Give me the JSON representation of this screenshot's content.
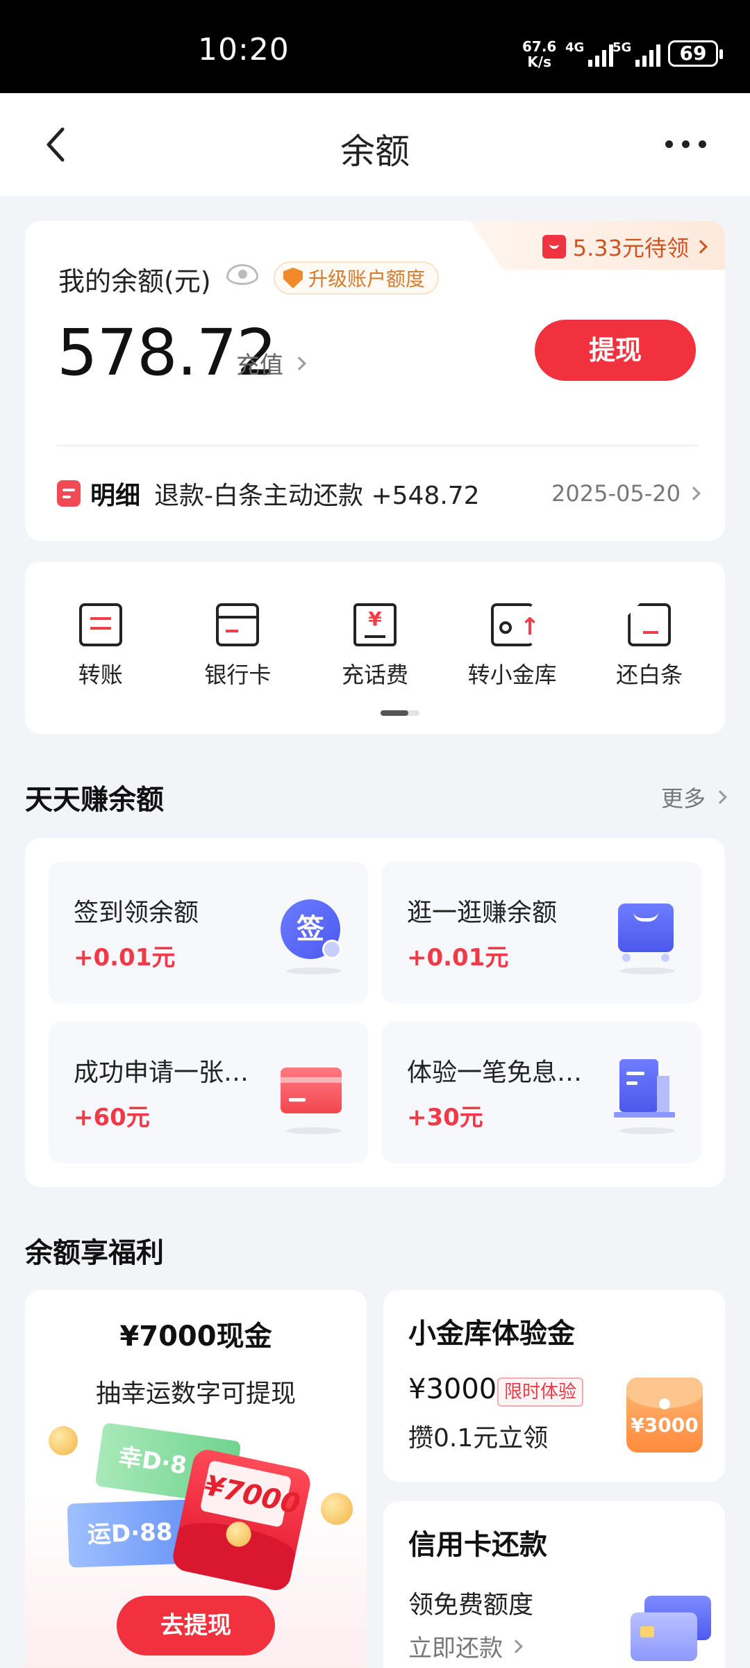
{
  "status_bar": {
    "time": "10:20",
    "net_speed_value": "67.6",
    "net_speed_unit": "K/s",
    "sim1_label": "4G",
    "sim2_label": "5G",
    "battery": "69"
  },
  "header": {
    "title": "余额"
  },
  "balance": {
    "promo_text": "5.33元待领",
    "label": "我的余额(元)",
    "upgrade_label": "升级账户额度",
    "amount": "578.72",
    "recharge_label": "充值",
    "withdraw_label": "提现",
    "detail_title": "明细",
    "detail_desc": "退款-白条主动还款 +548.72",
    "detail_date": "2025-05-20"
  },
  "quick_actions": [
    {
      "label": "转账",
      "icon": "transfer-icon"
    },
    {
      "label": "银行卡",
      "icon": "bank-card-icon"
    },
    {
      "label": "充话费",
      "icon": "phone-recharge-icon"
    },
    {
      "label": "转小金库",
      "icon": "vault-transfer-icon"
    },
    {
      "label": "还白条",
      "icon": "repay-icon"
    }
  ],
  "earn": {
    "title": "天天赚余额",
    "more_label": "更多",
    "tasks": [
      {
        "name": "签到领余额",
        "reward": "+0.01元",
        "icon_text": "签"
      },
      {
        "name": "逛一逛赚余额",
        "reward": "+0.01元"
      },
      {
        "name": "成功申请一张…",
        "reward": "+60元"
      },
      {
        "name": "体验一笔免息…",
        "reward": "+30元"
      }
    ]
  },
  "benefits": {
    "title": "余额享福利",
    "cash": {
      "title": "¥7000现金",
      "subtitle": "抽幸运数字可提现",
      "ticket_green": "幸D·8",
      "ticket_blue": "运D·88",
      "envelope_amount": "¥7000",
      "button_label": "去提现"
    },
    "vault": {
      "title": "小金库体验金",
      "price": "¥3000",
      "tag": "限时体验",
      "desc": "攒0.1元立领",
      "envelope_amount": "¥3000"
    },
    "credit": {
      "title": "信用卡还款",
      "desc": "领免费额度",
      "link": "立即还款"
    }
  },
  "colors": {
    "accent_red": "#f2313f",
    "promo_orange": "#d0531f",
    "page_bg": "#f3f4f8"
  }
}
